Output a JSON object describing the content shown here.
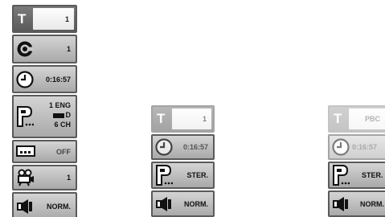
{
  "panels": [
    {
      "title": {
        "letter": "T",
        "value": "1"
      },
      "chapter": {
        "value": "1"
      },
      "time": {
        "value": "0:16:57"
      },
      "audio": {
        "line1": "1  ENG",
        "line2": "D",
        "line3": "6  CH"
      },
      "subtitle": {
        "value": "OFF"
      },
      "angle": {
        "value": "1"
      },
      "sound": {
        "value": "NORM."
      }
    },
    {
      "title": {
        "letter": "T",
        "value": "1"
      },
      "time": {
        "value": "0:16:57"
      },
      "audio": {
        "value": "STER."
      },
      "sound": {
        "value": "NORM."
      }
    },
    {
      "title": {
        "letter": "T",
        "value": "PBC"
      },
      "time": {
        "value": "0:16:57"
      },
      "audio": {
        "value": "STER."
      },
      "sound": {
        "value": "NORM."
      }
    }
  ]
}
